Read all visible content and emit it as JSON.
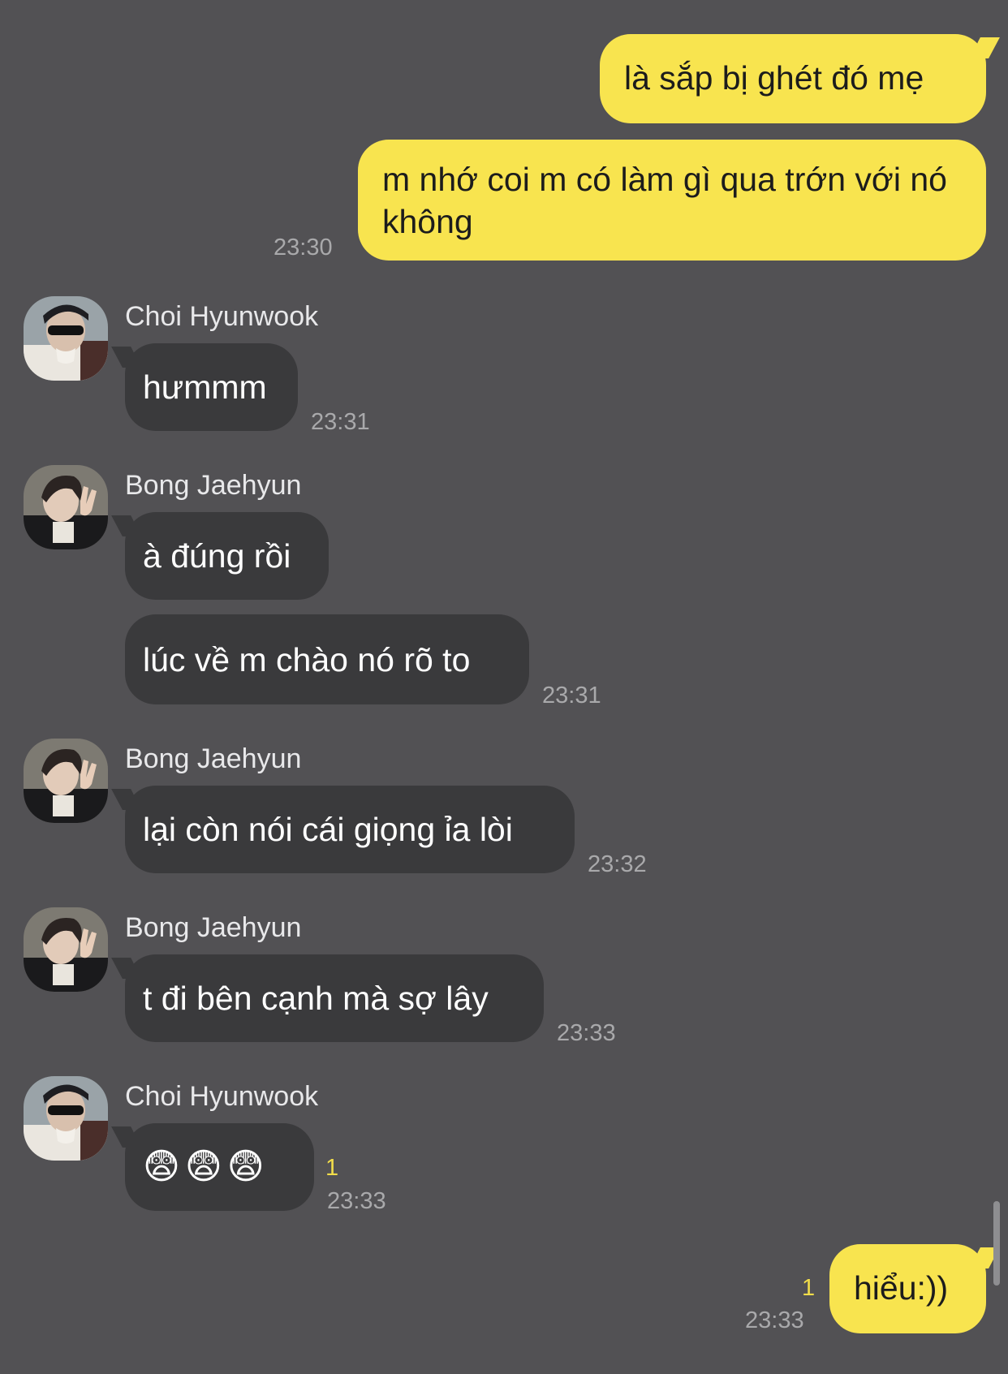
{
  "messages": {
    "m1": {
      "text": "là sắp bị ghét đó mẹ"
    },
    "m2": {
      "text": "m nhớ coi m có làm gì qua trớn với nó không",
      "time": "23:30"
    },
    "m3": {
      "sender": "Choi Hyunwook",
      "text": "hưmmm",
      "time": "23:31"
    },
    "m4": {
      "sender": "Bong Jaehyun",
      "text": "à đúng rồi"
    },
    "m5": {
      "text": "lúc về m chào nó rõ to",
      "time": "23:31"
    },
    "m6": {
      "sender": "Bong Jaehyun",
      "text": "lại còn nói cái giọng ỉa lòi",
      "time": "23:32"
    },
    "m7": {
      "sender": "Bong Jaehyun",
      "text": "t đi bên cạnh mà sợ lây",
      "time": "23:33"
    },
    "m8": {
      "sender": "Choi Hyunwook",
      "text": "😨😨😨",
      "time": "23:33",
      "unread": "1"
    },
    "m9": {
      "text": "hiểu:))",
      "time": "23:33",
      "unread": "1"
    }
  },
  "avatars": {
    "choi": "avatar-choi-hyunwook",
    "bong": "avatar-bong-jaehyun"
  },
  "colors": {
    "background": "#525154",
    "outgoing_bubble": "#f8e44f",
    "incoming_bubble": "#3a3a3c",
    "timestamp": "#a9a9ab",
    "unread_count": "#f2dd4a"
  }
}
